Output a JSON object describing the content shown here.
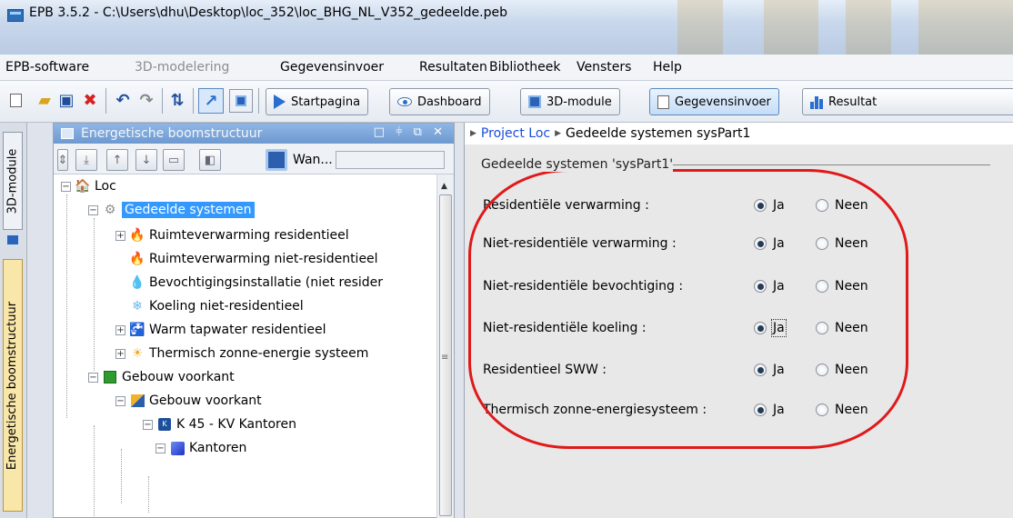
{
  "window": {
    "title": "EPB 3.5.2 - C:\\Users\\dhu\\Desktop\\loc_352\\loc_BHG_NL_V352_gedeelde.peb"
  },
  "menu": [
    {
      "label": "EPB-software",
      "disabled": false
    },
    {
      "label": "3D-modelering",
      "disabled": true
    },
    {
      "label": "Gegevensinvoer",
      "disabled": false
    },
    {
      "label": "Resultaten",
      "disabled": false
    },
    {
      "label": "Bibliotheek",
      "disabled": false
    },
    {
      "label": "Vensters",
      "disabled": false
    },
    {
      "label": "Help",
      "disabled": false
    }
  ],
  "toolbar": {
    "startpagina": "Startpagina",
    "dashboard": "Dashboard",
    "module3d": "3D-module",
    "gegevensinvoer": "Gegevensinvoer",
    "resultaten": "Resultat"
  },
  "side_tabs": {
    "module3d": "3D-module",
    "tree": "Energetische boomstructuur"
  },
  "tree_panel": {
    "title": "Energetische boomstructuur",
    "controls": "□ ⫩ ⧉ ✕",
    "view_label": "Wan...",
    "nodes": [
      {
        "label": "Loc",
        "icon": "building-icon",
        "expander": "minus"
      },
      {
        "label": "Gedeelde systemen",
        "icon": "gears-icon",
        "expander": "minus",
        "selected": true
      },
      {
        "label": "Ruimteverwarming residentieel",
        "icon": "flame-icon",
        "expander": "plus"
      },
      {
        "label": "Ruimteverwarming niet-residentieel",
        "icon": "flame-icon",
        "expander": "none"
      },
      {
        "label": "Bevochtigingsinstallatie (niet resider",
        "icon": "droplet-icon",
        "expander": "none"
      },
      {
        "label": "Koeling niet-residentieel",
        "icon": "snowflake-icon",
        "expander": "none"
      },
      {
        "label": "Warm tapwater residentieel",
        "icon": "tap-icon",
        "expander": "plus"
      },
      {
        "label": "Thermisch zonne-energie systeem",
        "icon": "sun-icon",
        "expander": "plus"
      },
      {
        "label": "Gebouw voorkant",
        "icon": "green-cube-icon",
        "expander": "minus"
      },
      {
        "label": "Gebouw voorkant",
        "icon": "folder-cube-icon",
        "expander": "minus"
      },
      {
        "label": "K 45 - KV Kantoren",
        "icon": "kv-icon",
        "expander": "minus"
      },
      {
        "label": "Kantoren",
        "icon": "blue-cube-icon",
        "expander": "minus"
      }
    ]
  },
  "breadcrumb": [
    "Project Loc",
    "Gedeelde systemen sysPart1"
  ],
  "form": {
    "section_title": "Gedeelde systemen 'sysPart1'",
    "yes_label": "Ja",
    "no_label": "Neen",
    "rows": [
      {
        "label": "Residentiële verwarming :",
        "value": "Ja"
      },
      {
        "label": "Niet-residentiële verwarming :",
        "value": "Ja"
      },
      {
        "label": "Niet-residentiële bevochtiging :",
        "value": "Ja"
      },
      {
        "label": "Niet-residentiële koeling :",
        "value": "Ja",
        "focused": true
      },
      {
        "label": "Residentieel SWW :",
        "value": "Ja"
      },
      {
        "label": "Thermisch zonne-energiesysteem :",
        "value": "Ja"
      }
    ]
  },
  "colors": {
    "selection": "#3399ff",
    "annotation": "#e0191b",
    "link": "#1a4ed8"
  }
}
